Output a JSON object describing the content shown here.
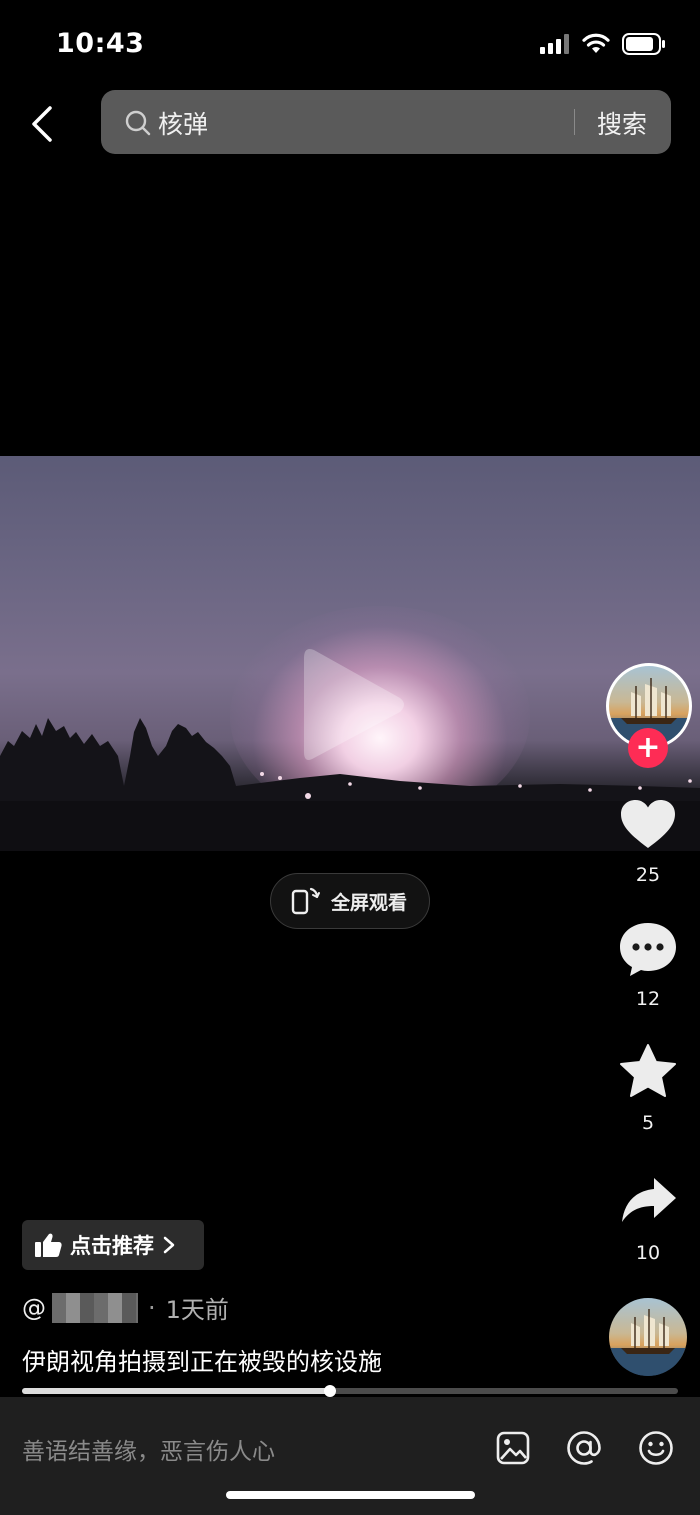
{
  "status": {
    "time": "10:43"
  },
  "search": {
    "query": "核弹",
    "button_label": "搜索"
  },
  "video": {
    "fullscreen_label": "全屏观看"
  },
  "rail": {
    "likes": "25",
    "comments": "12",
    "favorites": "5",
    "shares": "10"
  },
  "recommend_label": "点击推荐",
  "post": {
    "author_prefix": "@",
    "time_ago": "1天前",
    "separator": "·",
    "caption": "伊朗视角拍摄到正在被毁的核设施"
  },
  "progress": {
    "fraction": 0.47
  },
  "comment_bar": {
    "placeholder": "善语结善缘，恶言伤人心"
  }
}
